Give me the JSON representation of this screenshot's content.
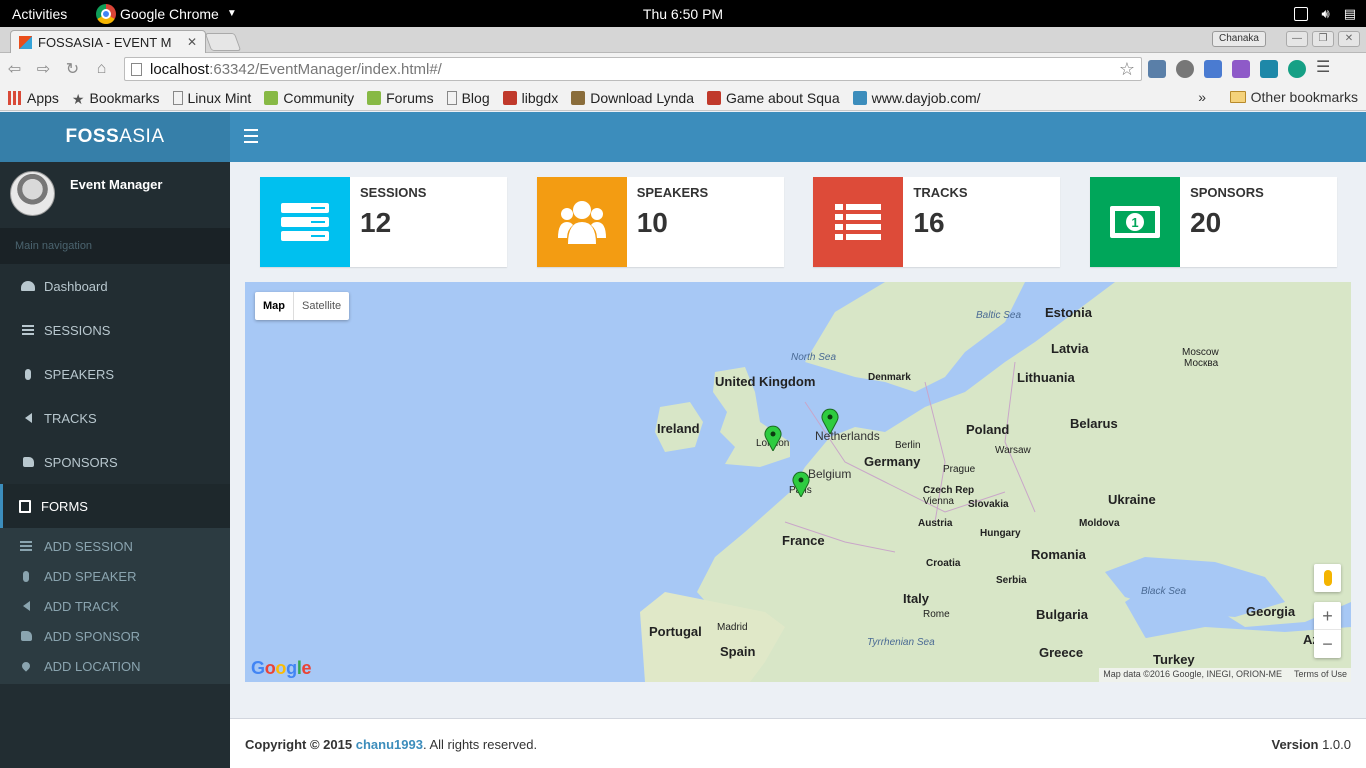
{
  "desktop": {
    "activities": "Activities",
    "app_name": "Google Chrome",
    "clock": "Thu  6:50 PM"
  },
  "browser": {
    "tab_title": "FOSSASIA - EVENT M",
    "profile": "Chanaka",
    "url_host": "localhost",
    "url_path": ":63342/EventManager/index.html#/",
    "bookmarks": [
      {
        "label": "Apps",
        "icon": "apps-grid-icon",
        "color": "#d94a38"
      },
      {
        "label": "Bookmarks",
        "icon": "star-icon",
        "color": "#555555"
      },
      {
        "label": "Linux Mint",
        "icon": "page-icon",
        "color": "#888888"
      },
      {
        "label": "Community",
        "icon": "mint-icon",
        "color": "#87b945"
      },
      {
        "label": "Forums",
        "icon": "mint-icon",
        "color": "#87b945"
      },
      {
        "label": "Blog",
        "icon": "page-icon",
        "color": "#888888"
      },
      {
        "label": "libgdx",
        "icon": "libgdx-icon",
        "color": "#c0392b"
      },
      {
        "label": "Download Lynda",
        "icon": "shield-icon",
        "color": "#8a6d3b"
      },
      {
        "label": "Game about Squa",
        "icon": "game-icon",
        "color": "#c0392b"
      },
      {
        "label": "www.dayjob.com/",
        "icon": "dayjob-icon",
        "color": "#3c8dbc"
      }
    ],
    "overflow": "»",
    "other_bookmarks": "Other bookmarks"
  },
  "app": {
    "logo_bold": "FOSS",
    "logo_rest": "ASIA",
    "user_name": "Event Manager",
    "nav_header": "Main navigation",
    "nav": [
      {
        "label": "Dashboard",
        "icon": "dashboard-icon"
      },
      {
        "label": "SESSIONS",
        "icon": "list-icon"
      },
      {
        "label": "SPEAKERS",
        "icon": "microphone-icon"
      },
      {
        "label": "TRACKS",
        "icon": "volume-icon"
      },
      {
        "label": "SPONSORS",
        "icon": "thumbs-up-icon"
      },
      {
        "label": "FORMS",
        "icon": "form-icon"
      }
    ],
    "submenu": [
      {
        "label": "ADD SESSION",
        "icon": "list-icon"
      },
      {
        "label": "ADD SPEAKER",
        "icon": "microphone-icon"
      },
      {
        "label": "ADD TRACK",
        "icon": "volume-icon"
      },
      {
        "label": "ADD SPONSOR",
        "icon": "thumbs-up-icon"
      },
      {
        "label": "ADD LOCATION",
        "icon": "map-marker-icon"
      }
    ]
  },
  "stats": [
    {
      "label": "SESSIONS",
      "value": "12",
      "color": "#00c0ef",
      "icon": "server-icon"
    },
    {
      "label": "SPEAKERS",
      "value": "10",
      "color": "#f39c12",
      "icon": "users-icon"
    },
    {
      "label": "TRACKS",
      "value": "16",
      "color": "#dd4b39",
      "icon": "list-icon"
    },
    {
      "label": "SPONSORS",
      "value": "20",
      "color": "#00a65a",
      "icon": "money-icon"
    }
  ],
  "map": {
    "type_map": "Map",
    "type_satellite": "Satellite",
    "countries": [
      "United Kingdom",
      "Ireland",
      "Netherlands",
      "Belgium",
      "Germany",
      "France",
      "Spain",
      "Portugal",
      "Italy",
      "Poland",
      "Latvia",
      "Lithuania",
      "Estonia",
      "Belarus",
      "Ukraine",
      "Denmark",
      "Czech Rep",
      "Slovakia",
      "Austria",
      "Hungary",
      "Romania",
      "Moldova",
      "Croatia",
      "Serbia",
      "Bulgaria",
      "Greece",
      "Turkey",
      "Georgia",
      "Azer"
    ],
    "cities": [
      "London",
      "Paris",
      "Berlin",
      "Prague",
      "Vienna",
      "Warsaw",
      "Madrid",
      "Rome",
      "Moscow",
      "Москва"
    ],
    "seas": [
      "Baltic Sea",
      "North Sea",
      "Black Sea",
      "Tyrrhenian Sea"
    ],
    "markers": [
      "London",
      "Netherlands",
      "Paris"
    ],
    "google": "Google",
    "attribution": "Map data ©2016 Google, INEGI, ORION-ME",
    "terms": "Terms of Use",
    "zoom_in": "+",
    "zoom_out": "−"
  },
  "footer": {
    "copyright": "Copyright © 2015",
    "author": "chanu1993",
    "rights": ". All rights reserved.",
    "version_label": "Version",
    "version": "1.0.0"
  }
}
